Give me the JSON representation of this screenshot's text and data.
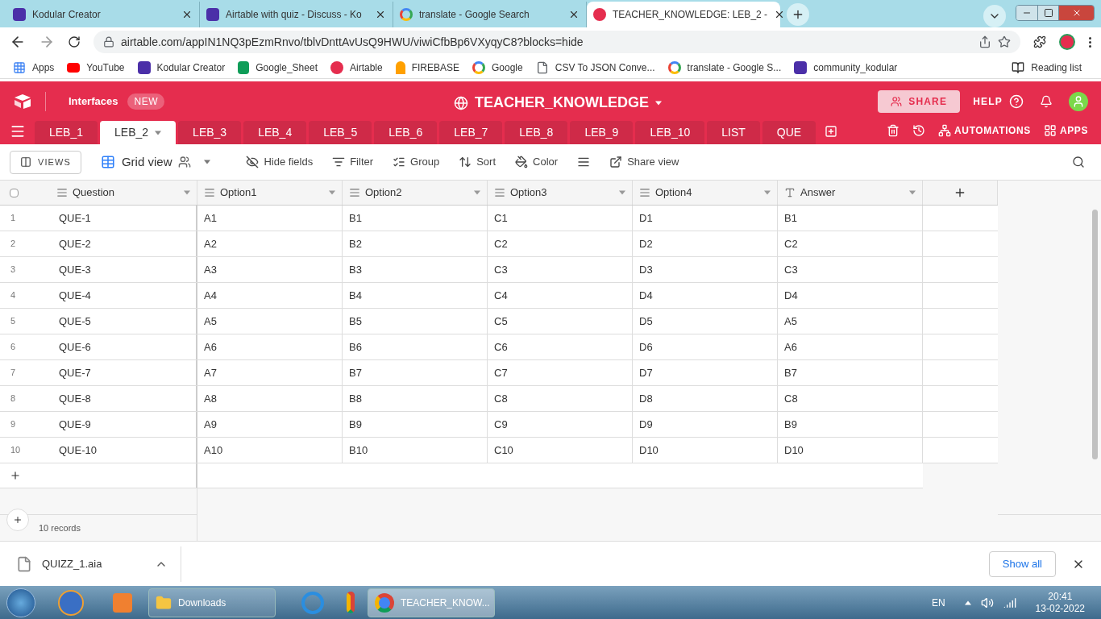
{
  "browser_tabs": [
    {
      "title": "Kodular Creator",
      "selected": false
    },
    {
      "title": "Airtable with quiz - Discuss - Ko",
      "selected": false
    },
    {
      "title": "translate - Google Search",
      "selected": false
    },
    {
      "title": "TEACHER_KNOWLEDGE: LEB_2 -",
      "selected": true
    }
  ],
  "address": "airtable.com/appIN1NQ3pEzmRnvo/tblvDnttAvUsQ9HWU/viwiCfbBp6VXyqyC8?blocks=hide",
  "bookmarks": [
    {
      "label": "Apps"
    },
    {
      "label": "YouTube"
    },
    {
      "label": "Kodular Creator"
    },
    {
      "label": "Google_Sheet"
    },
    {
      "label": "Airtable"
    },
    {
      "label": "FIREBASE"
    },
    {
      "label": "Google"
    },
    {
      "label": "CSV To JSON Conve..."
    },
    {
      "label": "translate - Google S..."
    },
    {
      "label": "community_kodular"
    }
  ],
  "reading_list": "Reading list",
  "app_header": {
    "interfaces": "Interfaces",
    "badge": "NEW",
    "base_title": "TEACHER_KNOWLEDGE",
    "share": "SHARE",
    "help": "HELP"
  },
  "table_tabs": [
    {
      "label": "LEB_1",
      "selected": false
    },
    {
      "label": "LEB_2",
      "selected": true
    },
    {
      "label": "LEB_3",
      "selected": false
    },
    {
      "label": "LEB_4",
      "selected": false
    },
    {
      "label": "LEB_5",
      "selected": false
    },
    {
      "label": "LEB_6",
      "selected": false
    },
    {
      "label": "LEB_7",
      "selected": false
    },
    {
      "label": "LEB_8",
      "selected": false
    },
    {
      "label": "LEB_9",
      "selected": false
    },
    {
      "label": "LEB_10",
      "selected": false
    },
    {
      "label": "LIST",
      "selected": false
    },
    {
      "label": "QUE",
      "selected": false
    }
  ],
  "header_actions": {
    "automations": "AUTOMATIONS",
    "apps": "APPS"
  },
  "toolbar": {
    "views": "VIEWS",
    "view_name": "Grid view",
    "hide_fields": "Hide fields",
    "filter": "Filter",
    "group": "Group",
    "sort": "Sort",
    "color_button": "Color",
    "share_view": "Share view"
  },
  "table": {
    "select_all": {
      "checked": false
    },
    "columns": [
      {
        "name": "Question",
        "kind": "text"
      },
      {
        "name": "Option1",
        "kind": "text"
      },
      {
        "name": "Option2",
        "kind": "text"
      },
      {
        "name": "Option3",
        "kind": "text"
      },
      {
        "name": "Option4",
        "kind": "text"
      },
      {
        "name": "Answer",
        "kind": "single"
      }
    ],
    "rows": [
      {
        "number": "1",
        "cells": [
          "QUE-1",
          "A1",
          "B1",
          "C1",
          "D1",
          "B1"
        ]
      },
      {
        "number": "2",
        "cells": [
          "QUE-2",
          "A2",
          "B2",
          "C2",
          "D2",
          "C2"
        ]
      },
      {
        "number": "3",
        "cells": [
          "QUE-3",
          "A3",
          "B3",
          "C3",
          "D3",
          "C3"
        ]
      },
      {
        "number": "4",
        "cells": [
          "QUE-4",
          "A4",
          "B4",
          "C4",
          "D4",
          "D4"
        ]
      },
      {
        "number": "5",
        "cells": [
          "QUE-5",
          "A5",
          "B5",
          "C5",
          "D5",
          "A5"
        ]
      },
      {
        "number": "6",
        "cells": [
          "QUE-6",
          "A6",
          "B6",
          "C6",
          "D6",
          "A6"
        ]
      },
      {
        "number": "7",
        "cells": [
          "QUE-7",
          "A7",
          "B7",
          "C7",
          "D7",
          "B7"
        ]
      },
      {
        "number": "8",
        "cells": [
          "QUE-8",
          "A8",
          "B8",
          "C8",
          "D8",
          "C8"
        ]
      },
      {
        "number": "9",
        "cells": [
          "QUE-9",
          "A9",
          "B9",
          "C9",
          "D9",
          "B9"
        ]
      },
      {
        "number": "10",
        "cells": [
          "QUE-10",
          "A10",
          "B10",
          "C10",
          "D10",
          "D10"
        ]
      }
    ],
    "records": "10 records"
  },
  "download": {
    "file": "QUIZZ_1.aia",
    "show_all": "Show all"
  },
  "taskbar": {
    "windows": [
      {
        "label": "Downloads",
        "selected": false
      },
      {
        "label": "TEACHER_KNOW...",
        "selected": true
      }
    ],
    "language": "EN",
    "time": "20:41",
    "date": "13-02-2022"
  }
}
